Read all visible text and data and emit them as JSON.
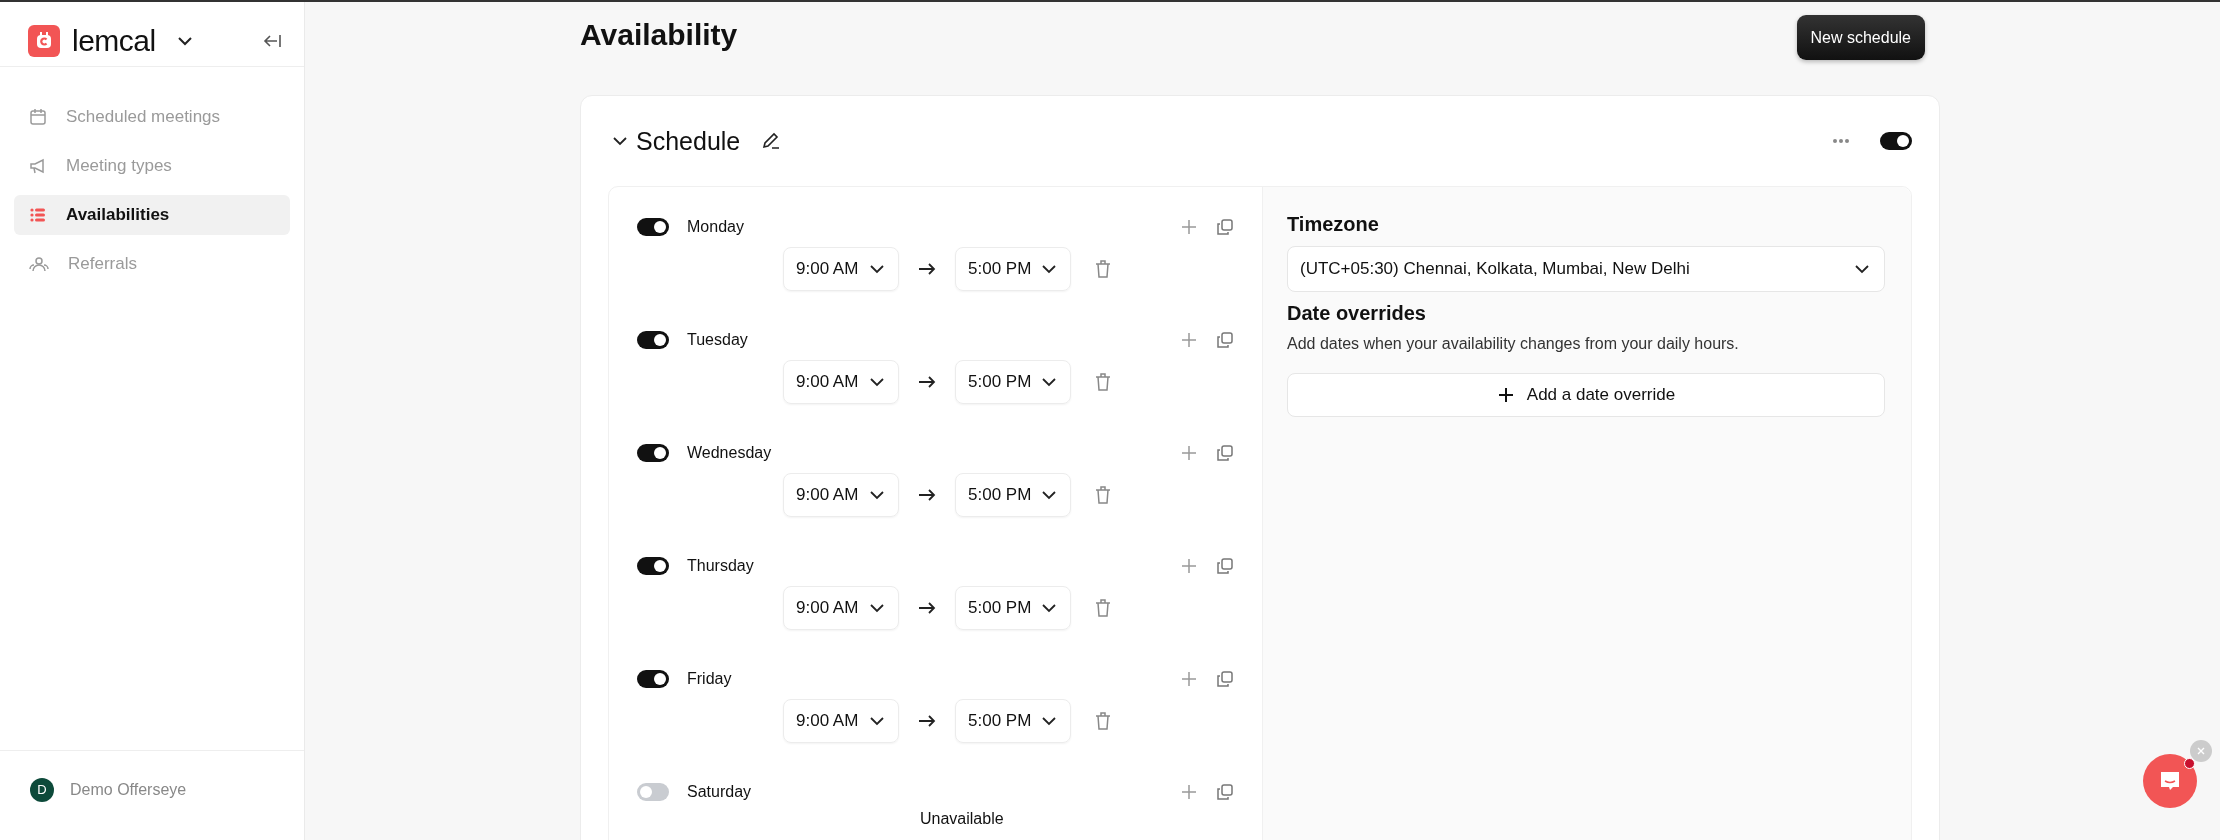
{
  "sidebar": {
    "brand": "lemcal",
    "items": [
      {
        "label": "Scheduled meetings",
        "selected": false
      },
      {
        "label": "Meeting types",
        "selected": false
      },
      {
        "label": "Availabilities",
        "selected": true
      },
      {
        "label": "Referrals",
        "selected": false
      }
    ],
    "user": {
      "initial": "D",
      "name": "Demo Offerseye"
    }
  },
  "page": {
    "title": "Availability",
    "new_button": "New schedule"
  },
  "schedule": {
    "title": "Schedule",
    "enabled": true,
    "days": [
      {
        "name": "Monday",
        "on": true,
        "slots": [
          {
            "start": "9:00 AM",
            "end": "5:00 PM"
          }
        ]
      },
      {
        "name": "Tuesday",
        "on": true,
        "slots": [
          {
            "start": "9:00 AM",
            "end": "5:00 PM"
          }
        ]
      },
      {
        "name": "Wednesday",
        "on": true,
        "slots": [
          {
            "start": "9:00 AM",
            "end": "5:00 PM"
          }
        ]
      },
      {
        "name": "Thursday",
        "on": true,
        "slots": [
          {
            "start": "9:00 AM",
            "end": "5:00 PM"
          }
        ]
      },
      {
        "name": "Friday",
        "on": true,
        "slots": [
          {
            "start": "9:00 AM",
            "end": "5:00 PM"
          }
        ]
      },
      {
        "name": "Saturday",
        "on": false,
        "note": "Unavailable"
      }
    ],
    "timezone_label": "Timezone",
    "timezone": "(UTC+05:30) Chennai, Kolkata, Mumbai, New Delhi",
    "overrides_title": "Date overrides",
    "overrides_text": "Add dates when your availability changes from your daily hours.",
    "add_override": "Add a date override"
  }
}
